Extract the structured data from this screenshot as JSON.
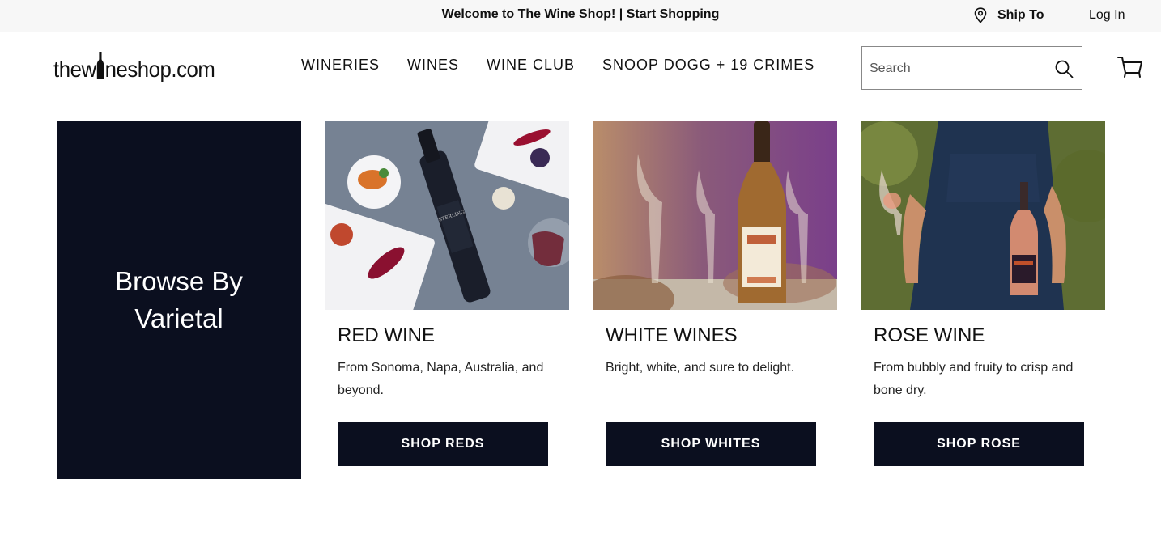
{
  "announcement": {
    "welcome_text": "Welcome to The Wine Shop! | ",
    "start_link": "Start Shopping",
    "ship_to": "Ship To",
    "login": "Log In"
  },
  "header": {
    "logo": {
      "pre": "the",
      "w": "w",
      "post": "neshop.com"
    },
    "nav": [
      "WINERIES",
      "WINES",
      "WINE CLUB",
      "SNOOP DOGG + 19 CRIMES"
    ],
    "search_placeholder": "Search"
  },
  "browse": {
    "title": "Browse By Varietal"
  },
  "cards": [
    {
      "title": "RED WINE",
      "description": "From Sonoma, Napa, Australia, and beyond.",
      "button": "SHOP REDS"
    },
    {
      "title": "WHITE WINES",
      "description": "Bright, white, and sure to delight.",
      "button": "SHOP WHITES"
    },
    {
      "title": "ROSE WINE",
      "description": "From bubbly and fruity to crisp and bone dry.",
      "button": "SHOP ROSE"
    }
  ],
  "colors": {
    "brand_navy": "#0b0f1f",
    "topbar_bg": "#f7f7f7"
  },
  "icons": [
    "location-pin-icon",
    "search-icon",
    "cart-icon",
    "wine-bottle-icon"
  ]
}
